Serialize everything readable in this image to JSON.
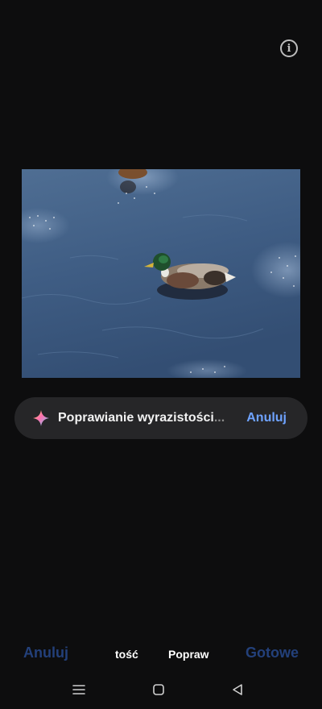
{
  "header": {
    "info_icon": "info-icon"
  },
  "photo": {
    "subject": "duck-on-water-photo"
  },
  "progress": {
    "label": "Poprawianie wyrazistości",
    "ellipsis": "...",
    "cancel_label": "Anuluj",
    "icon": "sparkle-icon",
    "accent_color": "#6fa3ff"
  },
  "bottom_bar": {
    "cancel_label": "Anuluj",
    "done_label": "Gotowe",
    "tabs": [
      {
        "label": "tość"
      },
      {
        "label": "Popraw"
      }
    ],
    "disabled_color": "#23407a"
  },
  "nav": {
    "recent_icon": "recent-apps-icon",
    "home_icon": "home-icon",
    "back_icon": "back-icon"
  }
}
